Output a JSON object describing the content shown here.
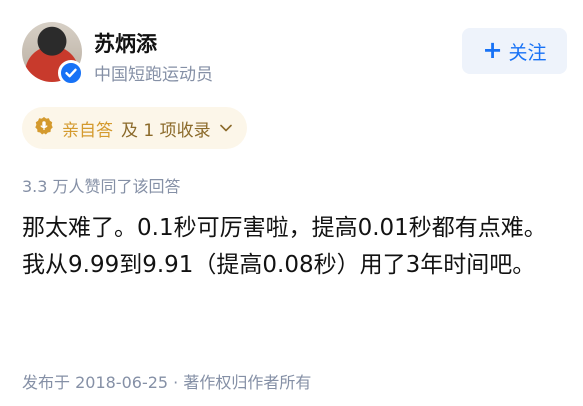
{
  "author": {
    "name": "苏炳添",
    "title": "中国短跑运动员",
    "avatar_icon": "avatar-photo",
    "verified_icon": "verified-check-icon"
  },
  "follow_button": {
    "icon": "plus-icon",
    "label": "关注"
  },
  "tag": {
    "icon": "microphone-badge-icon",
    "label": "亲自答",
    "collection": "及 1 项收录",
    "chevron_icon": "chevron-down-icon"
  },
  "stats": {
    "likes": "3.3 万人赞同了该回答"
  },
  "answer": {
    "text": "那太难了。0.1秒可厉害啦，提高0.01秒都有点难。我从9.99到9.91（提高0.08秒）用了3年时间吧。"
  },
  "footer": {
    "meta": "发布于 2018-06-25 · 著作权归作者所有"
  },
  "colors": {
    "accent": "#1772f6",
    "muted": "#8590a6",
    "tag_bg": "#fcf6e9",
    "tag_gold": "#d49a2e"
  }
}
